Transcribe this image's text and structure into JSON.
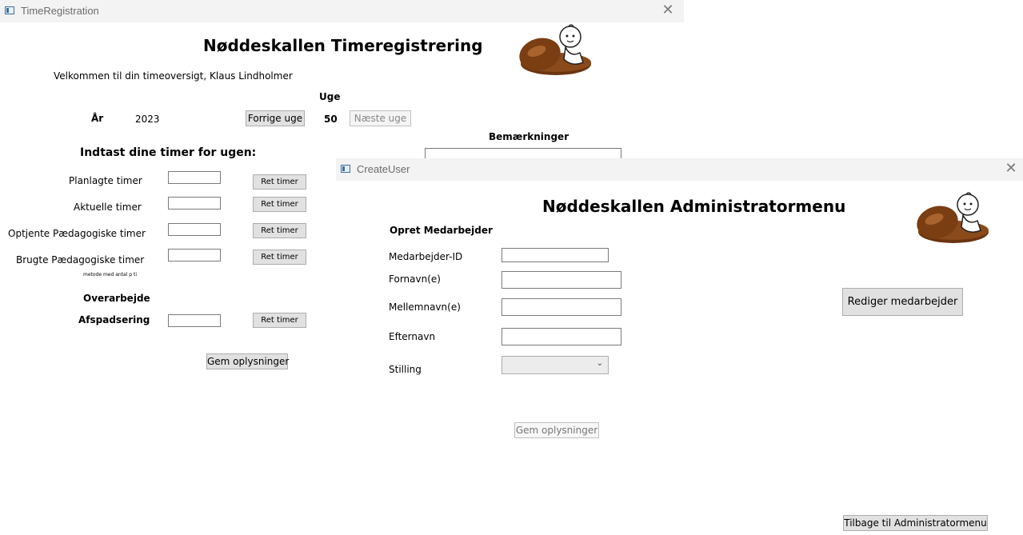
{
  "window1": {
    "title": "TimeRegistration",
    "close_glyph": "✕",
    "heading": "Nøddeskallen Timeregistrering",
    "welcome": "Velkommen til din timeoversigt, Klaus Lindholmer",
    "week_label": "Uge",
    "year_label": "År",
    "year_value": "2023",
    "prev_week": "Forrige uge",
    "week_value": "50",
    "next_week": "Næste uge",
    "remarks_label": "Bemærkninger",
    "enter_hours": "Indtast dine timer for ugen:",
    "rows": [
      {
        "label": "Planlagte timer",
        "button": "Ret timer"
      },
      {
        "label": "Aktuelle timer",
        "button": "Ret timer"
      },
      {
        "label": "Optjente Pædagogiske timer",
        "button": "Ret timer"
      },
      {
        "label": "Brugte Pædagogiske timer",
        "button": "Ret timer"
      }
    ],
    "method_note": "metode med antal p ti",
    "overtime_label": "Overarbejde",
    "timeoff_label": "Afspadsering",
    "timeoff_button": "Ret timer",
    "save_button": "Gem oplysninger"
  },
  "window2": {
    "title": "CreateUser",
    "close_glyph": "✕",
    "heading": "Nøddeskallen Administratormenu",
    "section_title": "Opret Medarbejder",
    "fields": {
      "employee_id": "Medarbejder-ID",
      "first_name": "Fornavn(e)",
      "middle_name": "Mellemnavn(e)",
      "last_name": "Efternavn",
      "position": "Stilling"
    },
    "position_chevron": "⌄",
    "save_button": "Gem oplysninger",
    "edit_employee_button": "Rediger medarbejder",
    "back_button": "Tilbage til Administratormenu"
  },
  "icons": [
    "app-window-icon",
    "close-icon",
    "nutshell-baby-logo",
    "chevron-down-icon"
  ],
  "colors": {
    "titlebar_bg": "#f3f3f3",
    "button_bg": "#e1e1e1",
    "nut_brown": "#7a3e12"
  }
}
